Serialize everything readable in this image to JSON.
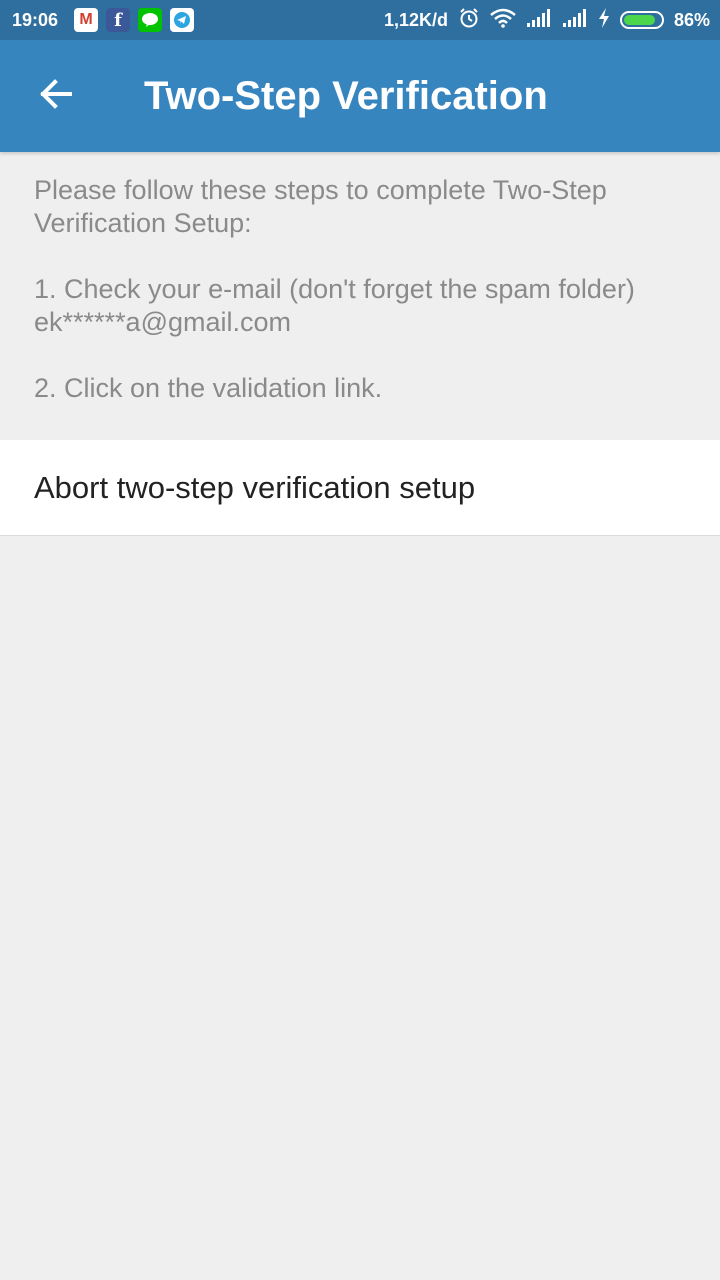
{
  "status_bar": {
    "time": "19:06",
    "notifications": [
      "gmail-icon",
      "facebook-icon",
      "line-icon",
      "telegram-icon"
    ],
    "network_speed": "1,12K/d",
    "battery_level": 0.86,
    "battery_text": "86%"
  },
  "app_bar": {
    "back_icon": "arrow-left-icon",
    "title": "Two-Step Verification"
  },
  "instructions": {
    "intro": "Please follow these steps to complete Two-Step Verification Setup:",
    "step1": "1. Check your e-mail (don't forget the spam folder)",
    "email": "ek******a@gmail.com",
    "step2": "2. Click on the validation link."
  },
  "abort": {
    "label": "Abort two-step verification setup"
  },
  "colors": {
    "status_bar": "#2f6f9f",
    "app_bar": "#3785bf",
    "background": "#efefef",
    "secondary_text": "#8a8a8a",
    "primary_text": "#222222"
  }
}
